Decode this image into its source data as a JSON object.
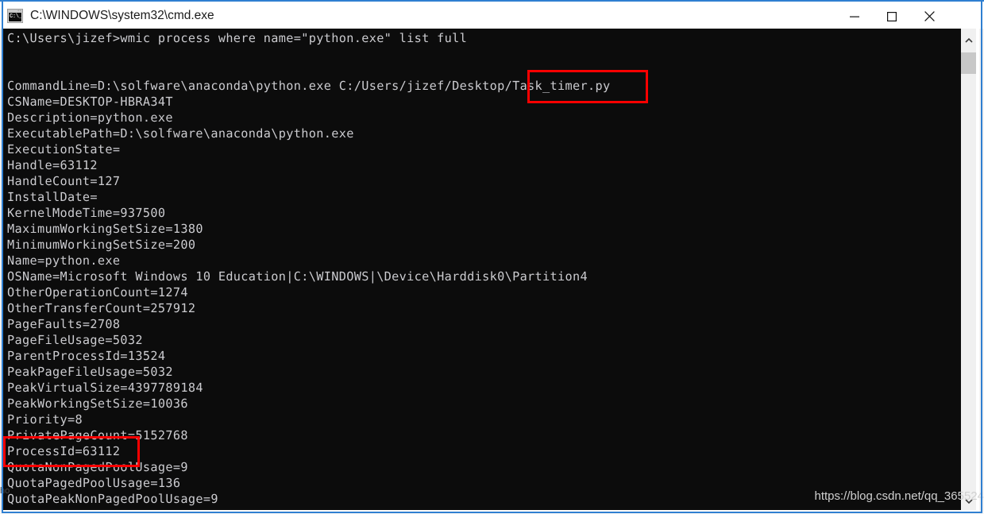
{
  "window": {
    "title": "C:\\WINDOWS\\system32\\cmd.exe",
    "icon": "console-icon",
    "icon_glyph": "C:\\_",
    "controls": {
      "minimize_label": "Minimize",
      "maximize_label": "Maximize",
      "close_label": "Close"
    },
    "accent_color": "#2f7fd1",
    "terminal_bg": "#0c0c0c",
    "terminal_fg": "#ccccd0",
    "annotation_color": "#fb0000"
  },
  "terminal": {
    "lines": [
      "C:\\Users\\jizef>wmic process where name=\"python.exe\" list full",
      "",
      "",
      "CommandLine=D:\\solfware\\anaconda\\python.exe C:/Users/jizef/Desktop/Task_timer.py",
      "CSName=DESKTOP-HBRA34T",
      "Description=python.exe",
      "ExecutablePath=D:\\solfware\\anaconda\\python.exe",
      "ExecutionState=",
      "Handle=63112",
      "HandleCount=127",
      "InstallDate=",
      "KernelModeTime=937500",
      "MaximumWorkingSetSize=1380",
      "MinimumWorkingSetSize=200",
      "Name=python.exe",
      "OSName=Microsoft Windows 10 Education|C:\\WINDOWS|\\Device\\Harddisk0\\Partition4",
      "OtherOperationCount=1274",
      "OtherTransferCount=257912",
      "PageFaults=2708",
      "PageFileUsage=5032",
      "ParentProcessId=13524",
      "PeakPageFileUsage=5032",
      "PeakVirtualSize=4397789184",
      "PeakWorkingSetSize=10036",
      "Priority=8",
      "PrivatePageCount=5152768",
      "ProcessId=63112",
      "QuotaNonPagedPoolUsage=9",
      "QuotaPagedPoolUsage=136",
      "QuotaPeakNonPagedPoolUsage=9"
    ]
  },
  "annotations": [
    {
      "name": "highlight-task-timer-path",
      "text": "/Task_timer.py"
    },
    {
      "name": "highlight-process-id",
      "text": "ProcessId=63112"
    }
  ],
  "watermark": {
    "text": "https://blog.csdn.net/qq_365524",
    "ghost_text": "ho"
  },
  "scrollbar": {
    "up_arrow": "chevron-up-icon",
    "down_arrow": "chevron-down-icon",
    "thumb": "scroll-thumb"
  }
}
